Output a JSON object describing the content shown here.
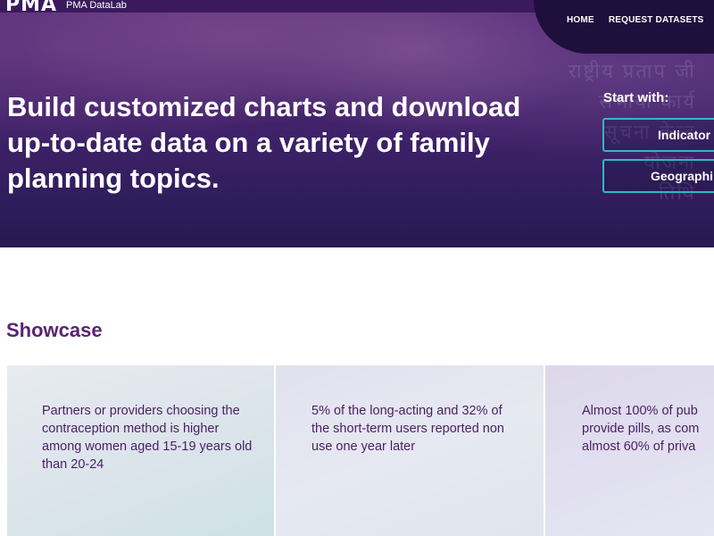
{
  "brand": {
    "logo": "PMA",
    "product": "PMA DataLab"
  },
  "nav": {
    "items": [
      "HOME",
      "REQUEST DATASETS"
    ]
  },
  "hero": {
    "headline": "Build customized charts and download up-to-date data on a variety of family planning topics.",
    "start_with": "Start with:",
    "buttons": [
      "Indicator",
      "Geographi"
    ]
  },
  "showcase": {
    "title": "Showcase",
    "cards": [
      "Partners or providers choosing the contraception method is higher among women aged 15-19 years old than 20-24",
      "5% of the long-acting and 32% of the short-term users reported non use one year later",
      "Almost 100% of pub provide pills, as com almost 60% of priva"
    ]
  },
  "colors": {
    "hero_dark": "#261a52",
    "hero_purple": "#5a2e7a",
    "accent_teal": "#34b6c4",
    "showcase_title": "#5a2370",
    "card_text": "#4a1f63"
  }
}
